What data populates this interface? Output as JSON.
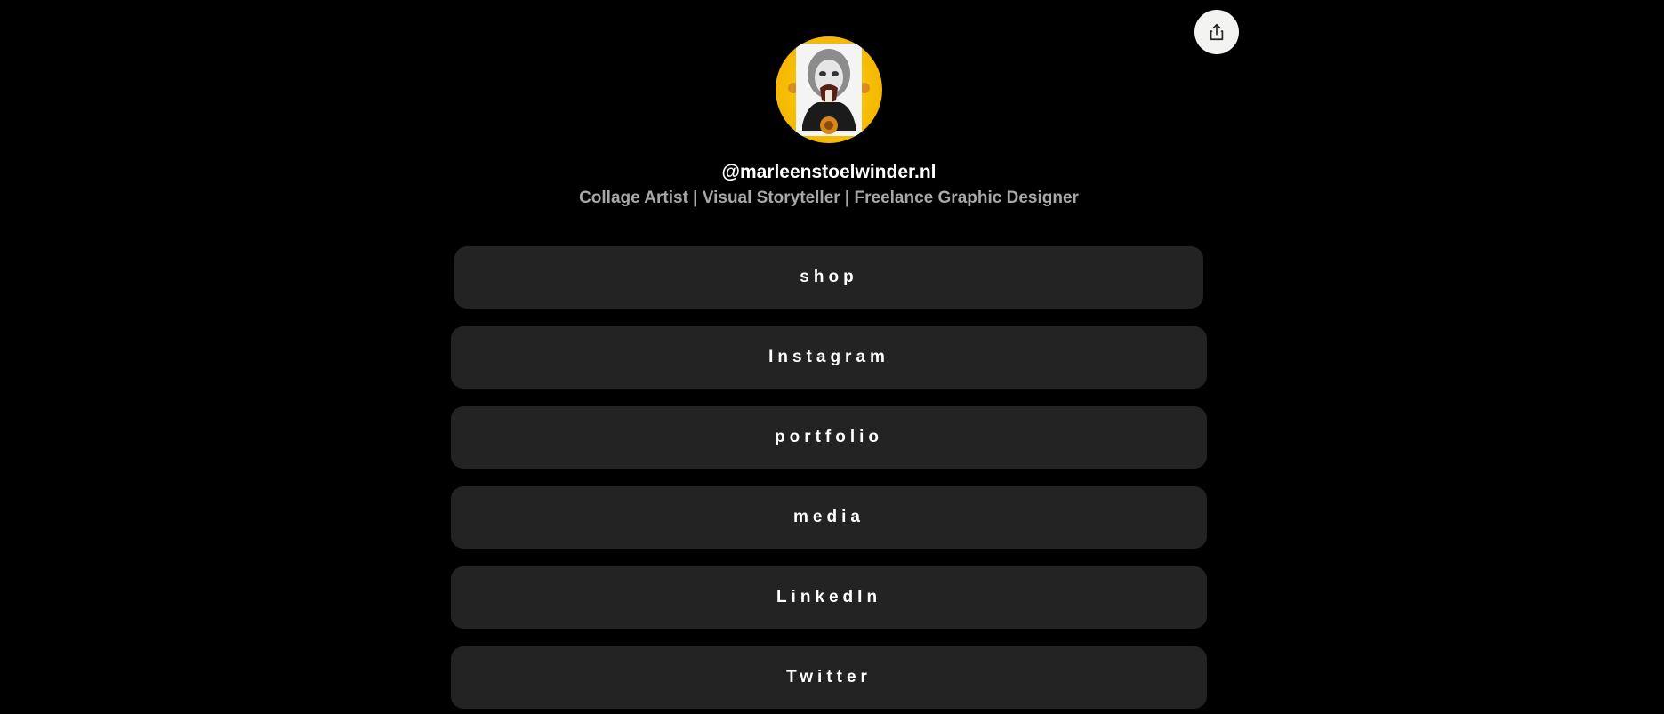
{
  "header": {
    "share_icon": "share-icon"
  },
  "profile": {
    "avatar_icon": "collage-portrait",
    "username": "@marleenstoelwinder.nl",
    "bio": "Collage Artist | Visual Storyteller | Freelance Graphic Designer"
  },
  "links": [
    {
      "label": "shop"
    },
    {
      "label": "Instagram"
    },
    {
      "label": "portfolio"
    },
    {
      "label": "media"
    },
    {
      "label": "LinkedIn"
    },
    {
      "label": "Twitter"
    }
  ],
  "colors": {
    "background": "#000000",
    "button": "#232323",
    "text": "#ffffff",
    "bio_text": "#a8a8a8",
    "avatar_ring": "#f5b800"
  }
}
